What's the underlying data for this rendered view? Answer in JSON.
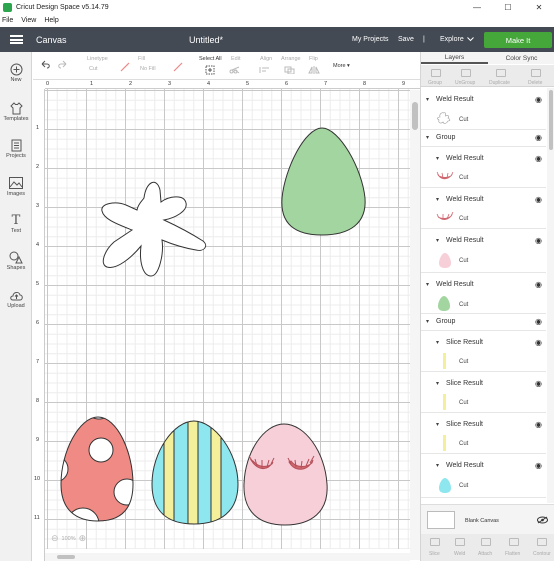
{
  "window": {
    "title": "Cricut Design Space  v5.14.79",
    "minimize": "—",
    "maximize": "☐",
    "close": "✕"
  },
  "menu": [
    "File",
    "View",
    "Help"
  ],
  "appbar": {
    "section": "Canvas",
    "project": "Untitled*",
    "my_projects": "My Projects",
    "save": "Save",
    "divider": "|",
    "machine": "Explore",
    "make_it": "Make It"
  },
  "sidebar": [
    {
      "label": "New",
      "icon": "plus-icon"
    },
    {
      "label": "Templates",
      "icon": "shirt-icon"
    },
    {
      "label": "Projects",
      "icon": "projects-icon"
    },
    {
      "label": "Images",
      "icon": "image-icon"
    },
    {
      "label": "Text",
      "icon": "text-icon"
    },
    {
      "label": "Shapes",
      "icon": "shapes-icon"
    },
    {
      "label": "Upload",
      "icon": "cloud-upload-icon"
    }
  ],
  "toolbar": {
    "linetype_label": "Linetype",
    "linetype_value": "Cut",
    "fill_label": "Fill",
    "fill_value": "No Fill",
    "select_all": "Select All",
    "edit": "Edit",
    "align": "Align",
    "arrange": "Arrange",
    "flip": "Flip",
    "more": "More ▾"
  },
  "ruler": {
    "top": [
      "0",
      "1",
      "2",
      "3",
      "4",
      "5",
      "6",
      "7",
      "8",
      "9"
    ],
    "left": [
      "1",
      "2",
      "3",
      "4",
      "5",
      "6",
      "7",
      "8",
      "9",
      "10",
      "11"
    ]
  },
  "zoom": "100%",
  "panel": {
    "tabs": [
      "Layers",
      "Color Sync"
    ],
    "actions": [
      "Group",
      "UnGroup",
      "Duplicate",
      "Delete"
    ],
    "layers": [
      {
        "name": "Weld Result",
        "sub": "Cut",
        "thumb": "flower",
        "level": 0,
        "toggle": "▾"
      },
      {
        "name": "Group",
        "level": 0,
        "toggle": "▾"
      },
      {
        "name": "Weld Result",
        "sub": "Cut",
        "thumb": "lashes-1",
        "level": 1,
        "toggle": "▾"
      },
      {
        "name": "Weld Result",
        "sub": "Cut",
        "thumb": "lashes-2",
        "level": 1,
        "toggle": "▾"
      },
      {
        "name": "Weld Result",
        "sub": "Cut",
        "thumb": "egg-pink",
        "level": 1,
        "toggle": "▾"
      },
      {
        "name": "Weld Result",
        "sub": "Cut",
        "thumb": "egg-green",
        "level": 0,
        "toggle": "▾"
      },
      {
        "name": "Group",
        "level": 0,
        "toggle": "▾"
      },
      {
        "name": "Slice Result",
        "sub": "Cut",
        "thumb": "stripe",
        "level": 1,
        "toggle": "▾"
      },
      {
        "name": "Slice Result",
        "sub": "Cut",
        "thumb": "stripe",
        "level": 1,
        "toggle": "▾"
      },
      {
        "name": "Slice Result",
        "sub": "Cut",
        "thumb": "stripe",
        "level": 1,
        "toggle": "▾"
      },
      {
        "name": "Weld Result",
        "sub": "Cut",
        "thumb": "egg-cyan",
        "level": 1,
        "toggle": "▾"
      }
    ],
    "blank_canvas": "Blank Canvas",
    "bottom_actions": [
      "Slice",
      "Weld",
      "Attach",
      "Flatten",
      "Contour"
    ]
  },
  "colors": {
    "appbar": "#434a54",
    "make_it": "#45a73a",
    "egg_green": "#a2d5a0",
    "egg_red": "#f08a85",
    "egg_cyan": "#8ee6ee",
    "egg_yellow": "#f3ef9a",
    "egg_pink": "#f7cfd8",
    "lashes": "#cf6770"
  }
}
